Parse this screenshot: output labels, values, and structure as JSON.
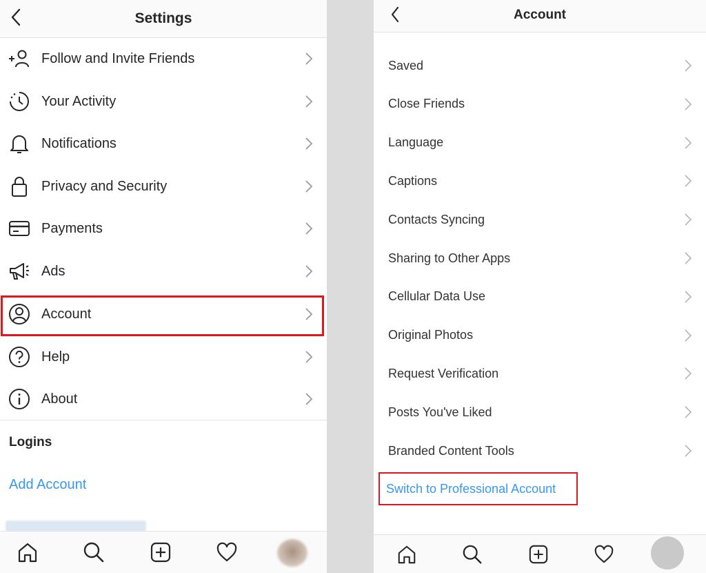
{
  "settings": {
    "title": "Settings",
    "items": [
      {
        "label": "Follow and Invite Friends",
        "icon": "add-person-icon"
      },
      {
        "label": "Your Activity",
        "icon": "activity-clock-icon"
      },
      {
        "label": "Notifications",
        "icon": "bell-icon"
      },
      {
        "label": "Privacy and Security",
        "icon": "lock-icon"
      },
      {
        "label": "Payments",
        "icon": "credit-card-icon"
      },
      {
        "label": "Ads",
        "icon": "megaphone-icon"
      },
      {
        "label": "Account",
        "icon": "person-circle-icon"
      },
      {
        "label": "Help",
        "icon": "help-circle-icon"
      },
      {
        "label": "About",
        "icon": "info-circle-icon"
      }
    ],
    "logins_title": "Logins",
    "add_account": "Add Account"
  },
  "account": {
    "title": "Account",
    "items": [
      {
        "label": "Saved"
      },
      {
        "label": "Close Friends"
      },
      {
        "label": "Language"
      },
      {
        "label": "Captions"
      },
      {
        "label": "Contacts Syncing"
      },
      {
        "label": "Sharing to Other Apps"
      },
      {
        "label": "Cellular Data Use"
      },
      {
        "label": "Original Photos"
      },
      {
        "label": "Request Verification"
      },
      {
        "label": "Posts You've Liked"
      },
      {
        "label": "Branded Content Tools"
      }
    ],
    "switch_link": "Switch to Professional Account"
  },
  "tabbar": {
    "icons": [
      "home-icon",
      "search-icon",
      "new-post-icon",
      "heart-icon",
      "profile-avatar"
    ]
  },
  "colors": {
    "highlight": "#e3161d",
    "link": "#3897f0",
    "text": "#262626"
  }
}
